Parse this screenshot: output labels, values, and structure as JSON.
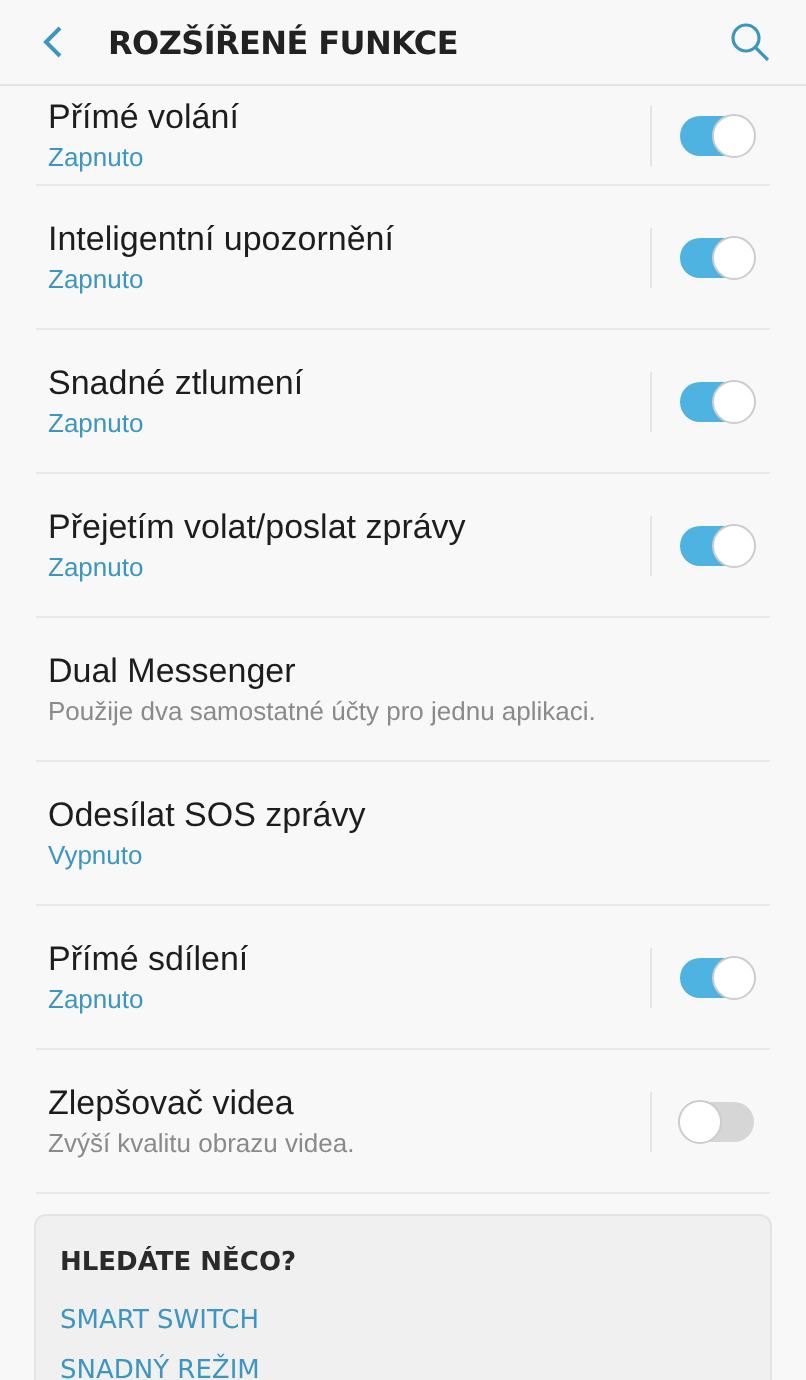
{
  "header": {
    "title": "ROZŠÍŘENÉ FUNKCE"
  },
  "settings": [
    {
      "title": "Přímé volání",
      "status": "Zapnuto",
      "kind": "toggle",
      "on": true
    },
    {
      "title": "Inteligentní upozornění",
      "status": "Zapnuto",
      "kind": "toggle",
      "on": true
    },
    {
      "title": "Snadné ztlumení",
      "status": "Zapnuto",
      "kind": "toggle",
      "on": true
    },
    {
      "title": "Přejetím volat/poslat zprávy",
      "status": "Zapnuto",
      "kind": "toggle",
      "on": true
    },
    {
      "title": "Dual Messenger",
      "description": "Použije dva samostatné účty pro jednu aplikaci.",
      "kind": "plain"
    },
    {
      "title": "Odesílat SOS zprávy",
      "status": "Vypnuto",
      "kind": "plain"
    },
    {
      "title": "Přímé sdílení",
      "status": "Zapnuto",
      "kind": "toggle",
      "on": true
    },
    {
      "title": "Zlepšovač videa",
      "description": "Zvýší kvalitu obrazu videa.",
      "kind": "toggle",
      "on": false
    }
  ],
  "suggestions": {
    "heading": "HLEDÁTE NĚCO?",
    "links": [
      "SMART SWITCH",
      "SNADNÝ REŽIM"
    ]
  }
}
